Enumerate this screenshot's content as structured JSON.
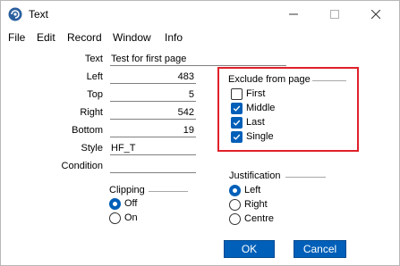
{
  "window": {
    "title": "Text",
    "icon": "app-logo-icon"
  },
  "menu": [
    "File",
    "Edit",
    "Record",
    "Window",
    "Info"
  ],
  "form": {
    "text": {
      "label": "Text",
      "value": "Test for first page"
    },
    "left": {
      "label": "Left",
      "value": "483"
    },
    "top": {
      "label": "Top",
      "value": "5"
    },
    "right": {
      "label": "Right",
      "value": "542"
    },
    "bottom": {
      "label": "Bottom",
      "value": "19"
    },
    "style": {
      "label": "Style",
      "value": "HF_T"
    },
    "condition": {
      "label": "Condition",
      "value": ""
    }
  },
  "exclude": {
    "title": "Exclude from page",
    "items": [
      {
        "label": "First",
        "checked": false
      },
      {
        "label": "Middle",
        "checked": true
      },
      {
        "label": "Last",
        "checked": true
      },
      {
        "label": "Single",
        "checked": true
      }
    ],
    "highlight_color": "#e0202a"
  },
  "clipping": {
    "title": "Clipping",
    "options": [
      {
        "label": "Off",
        "selected": true
      },
      {
        "label": "On",
        "selected": false
      }
    ]
  },
  "justification": {
    "title": "Justification",
    "options": [
      {
        "label": "Left",
        "selected": true
      },
      {
        "label": "Right",
        "selected": false
      },
      {
        "label": "Centre",
        "selected": false
      }
    ]
  },
  "buttons": {
    "ok": "OK",
    "cancel": "Cancel"
  },
  "colors": {
    "accent": "#005fb8"
  }
}
